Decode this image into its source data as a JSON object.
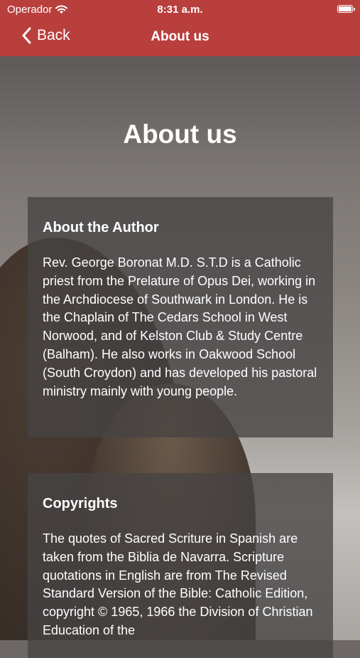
{
  "status_bar": {
    "carrier": "Operador",
    "time": "8:31 a.m."
  },
  "nav": {
    "back_label": "Back",
    "title": "About us"
  },
  "page": {
    "title": "About us"
  },
  "sections": [
    {
      "heading": "About the Author",
      "body": "Rev. George Boronat M.D. S.T.D is a Catholic priest from the Prelature of Opus Dei, working in the Archdiocese of Southwark in London. He is the Chaplain of The Cedars School in West Norwood, and of Kelston Club & Study Centre (Balham). He also works in Oakwood School (South Croydon) and has developed his pastoral ministry mainly with young people."
    },
    {
      "heading": "Copyrights",
      "body": "The quotes of Sacred Scriture in Spanish are taken from the Biblia de Navarra. Scripture quotations in English are from The Revised Standard Version of the Bible: Catholic Edition, copyright © 1965, 1966 the Division of Christian Education of the"
    }
  ],
  "colors": {
    "nav_background": "#b93f3d",
    "card_background": "#464444",
    "text": "#ffffff"
  },
  "icons": {
    "wifi": "wifi-icon",
    "battery": "battery-icon",
    "back": "chevron-left-icon"
  }
}
